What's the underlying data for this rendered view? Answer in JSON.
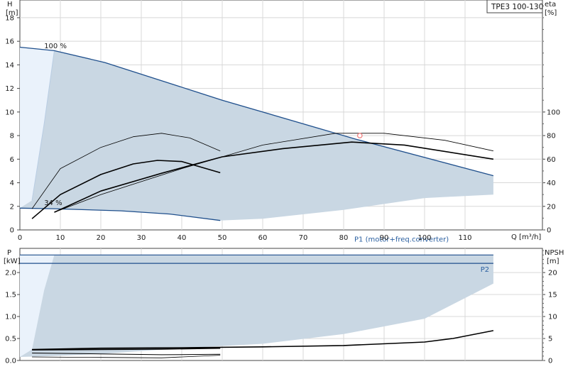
{
  "chart_title": "TPE3 100-130",
  "colors": {
    "envelope_fill": "#c9d7e3",
    "light_fill": "#eaf2fb",
    "boundary_line": "#1f4f8c",
    "curve": "#000000",
    "grid": "#d8d8d8",
    "duty_point": "#f08080",
    "p1_label": "#2a5fa0"
  },
  "chart_data": [
    {
      "type": "line",
      "name": "head-efficiency",
      "xlabel": "Q [m³/h]",
      "ylabel_left": "H",
      "ylabel_left_unit": "[m]",
      "ylabel_right": "eta",
      "ylabel_right_unit": "[%]",
      "x_ticks": [
        "0",
        "10",
        "20",
        "30",
        "40",
        "50",
        "60",
        "70",
        "80",
        "90",
        "100",
        "110"
      ],
      "y_ticks": [
        "0",
        "2",
        "4",
        "6",
        "8",
        "10",
        "12",
        "14",
        "16",
        "18"
      ],
      "y2_ticks": [
        "0",
        "20",
        "40",
        "60",
        "80",
        "100"
      ],
      "xlim": [
        0,
        130
      ],
      "ylim": [
        0,
        19.5
      ],
      "y2lim": [
        0,
        195
      ],
      "envelope": {
        "max_curve": [
          [
            0,
            15.5
          ],
          [
            8.5,
            15.2
          ],
          [
            21,
            14.2
          ],
          [
            50,
            11.0
          ],
          [
            83,
            7.7
          ],
          [
            117,
            4.6
          ]
        ],
        "min_curve": [
          [
            0,
            1.85
          ],
          [
            8,
            1.8
          ],
          [
            25,
            1.62
          ],
          [
            37,
            1.35
          ],
          [
            49.5,
            0.8
          ]
        ],
        "bottom_edge": [
          [
            49.5,
            0.8
          ],
          [
            60,
            0.95
          ],
          [
            80,
            1.7
          ],
          [
            100,
            2.7
          ],
          [
            117,
            3.0
          ]
        ],
        "light_region": [
          [
            0,
            1.85
          ],
          [
            3,
            2.5
          ],
          [
            6,
            9.0
          ],
          [
            8.5,
            15.2
          ],
          [
            0,
            15.5
          ]
        ]
      },
      "annotations": [
        {
          "text": "100 %",
          "x": 6,
          "y": 15.4
        },
        {
          "text": "34 %",
          "x": 6,
          "y": 2.1
        }
      ],
      "duty_point": {
        "x": 84,
        "y": 8.0
      },
      "series": [
        {
          "name": "eta_max",
          "axis": "right",
          "stroke": 0.8,
          "points": [
            [
              8.5,
              15
            ],
            [
              20,
              30
            ],
            [
              40,
              52
            ],
            [
              60,
              72
            ],
            [
              78,
              82
            ],
            [
              90,
              82
            ],
            [
              105,
              76
            ],
            [
              117,
              67
            ]
          ]
        },
        {
          "name": "H_max",
          "axis": "left",
          "stroke": 1.6,
          "points": [
            [
              8.5,
              1.5
            ],
            [
              20,
              3.3
            ],
            [
              35,
              4.8
            ],
            [
              50,
              6.2
            ],
            [
              65,
              6.9
            ],
            [
              82,
              7.45
            ],
            [
              95,
              7.2
            ],
            [
              117,
              6.0
            ]
          ]
        },
        {
          "name": "eta_mid",
          "axis": "right",
          "stroke": 0.8,
          "points": [
            [
              3,
              18
            ],
            [
              10,
              52
            ],
            [
              20,
              70
            ],
            [
              28,
              79
            ],
            [
              35,
              82
            ],
            [
              42,
              78
            ],
            [
              49.5,
              67
            ]
          ]
        },
        {
          "name": "H_mid",
          "axis": "left",
          "stroke": 1.6,
          "points": [
            [
              3,
              0.95
            ],
            [
              10,
              3.0
            ],
            [
              20,
              4.7
            ],
            [
              28,
              5.6
            ],
            [
              34,
              5.9
            ],
            [
              40,
              5.8
            ],
            [
              49.5,
              4.85
            ]
          ]
        }
      ]
    },
    {
      "type": "line",
      "name": "power-npsh",
      "ylabel_left": "P",
      "ylabel_left_unit": "[kW]",
      "ylabel_right": "NPSH",
      "ylabel_right_unit": "[m]",
      "y_ticks": [
        "0.0",
        "0.5",
        "1.0",
        "1.5",
        "2.0"
      ],
      "y2_ticks": [
        "0",
        "5",
        "10",
        "15",
        "20"
      ],
      "ylim": [
        0,
        2.55
      ],
      "y2lim": [
        0,
        25.5
      ],
      "series_labels": [
        {
          "text": "P1 (motor+freq.converter)",
          "x": 106,
          "y": 2.7
        },
        {
          "text": "P2",
          "x": 116,
          "y": 2.02
        }
      ],
      "envelope": {
        "top": [
          [
            0,
            2.4
          ],
          [
            117,
            2.4
          ]
        ],
        "right_bottom": [
          [
            117,
            1.75
          ],
          [
            100,
            0.95
          ],
          [
            80,
            0.6
          ],
          [
            60,
            0.38
          ],
          [
            40,
            0.28
          ],
          [
            20,
            0.15
          ],
          [
            8,
            0.1
          ],
          [
            0,
            0.08
          ]
        ],
        "light_region": [
          [
            0,
            0.08
          ],
          [
            3,
            0.25
          ],
          [
            6,
            1.6
          ],
          [
            8.5,
            2.4
          ],
          [
            0,
            2.4
          ]
        ]
      },
      "series": [
        {
          "name": "P1_line",
          "axis": "left",
          "stroke": 1.2,
          "color_key": "boundary_line",
          "points": [
            [
              0,
              2.4
            ],
            [
              117,
              2.4
            ]
          ]
        },
        {
          "name": "P2_line",
          "axis": "left",
          "stroke": 1.2,
          "color_key": "boundary_line",
          "points": [
            [
              0,
              2.21
            ],
            [
              117,
              2.21
            ]
          ]
        },
        {
          "name": "NPSH",
          "axis": "right",
          "stroke": 1.6,
          "color_key": "curve",
          "points": [
            [
              3,
              2.5
            ],
            [
              20,
              2.8
            ],
            [
              40,
              2.9
            ],
            [
              60,
              3.1
            ],
            [
              80,
              3.4
            ],
            [
              100,
              4.2
            ],
            [
              107,
              5.0
            ],
            [
              117,
              6.8
            ]
          ]
        },
        {
          "name": "P_low1",
          "axis": "left",
          "stroke": 1.6,
          "color_key": "curve",
          "points": [
            [
              3,
              0.24
            ],
            [
              20,
              0.25
            ],
            [
              35,
              0.26
            ],
            [
              49.5,
              0.28
            ]
          ]
        },
        {
          "name": "P_low2",
          "axis": "left",
          "stroke": 1.0,
          "color_key": "curve",
          "points": [
            [
              3,
              0.17
            ],
            [
              20,
              0.15
            ],
            [
              35,
              0.13
            ],
            [
              49.5,
              0.14
            ]
          ]
        },
        {
          "name": "P_low3",
          "axis": "left",
          "stroke": 0.8,
          "color_key": "curve",
          "points": [
            [
              3,
              0.08
            ],
            [
              20,
              0.07
            ],
            [
              35,
              0.06
            ],
            [
              49.5,
              0.12
            ]
          ]
        }
      ]
    }
  ]
}
